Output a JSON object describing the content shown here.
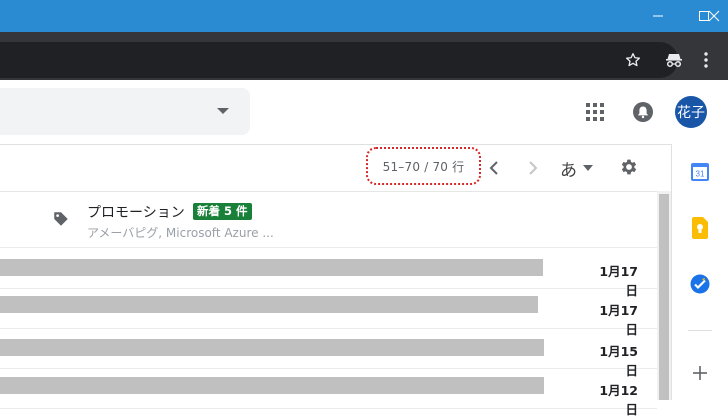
{
  "window": {
    "minimize": "minimize-icon",
    "maximize": "maximize-icon",
    "close": "close-icon"
  },
  "browser": {
    "icons": [
      "star-icon",
      "incognito-icon",
      "menu-dots-icon"
    ]
  },
  "header": {
    "icons": [
      "apps-grid-icon",
      "notifications-icon"
    ],
    "avatar_text": "花子"
  },
  "toolbar": {
    "page_range": "51–70 / 70 行",
    "input_tool_label": "あ"
  },
  "category": {
    "name": "プロモーション",
    "badge": "新着 5 件",
    "senders": "アメーバピグ, Microsoft Azure ..."
  },
  "emails": [
    {
      "date": "1月17日"
    },
    {
      "date": "1月17日"
    },
    {
      "date": "1月15日"
    },
    {
      "date": "1月12日"
    }
  ],
  "sidepanel": {
    "calendar_day": "31",
    "icons": [
      "calendar-icon",
      "keep-icon",
      "tasks-icon",
      "add-icon"
    ]
  },
  "colors": {
    "titlebar": "#2b8bd2",
    "browser_toolbar": "#35363a",
    "badge": "#188038",
    "avatar": "#1a56a8",
    "highlight": "#d62828"
  }
}
